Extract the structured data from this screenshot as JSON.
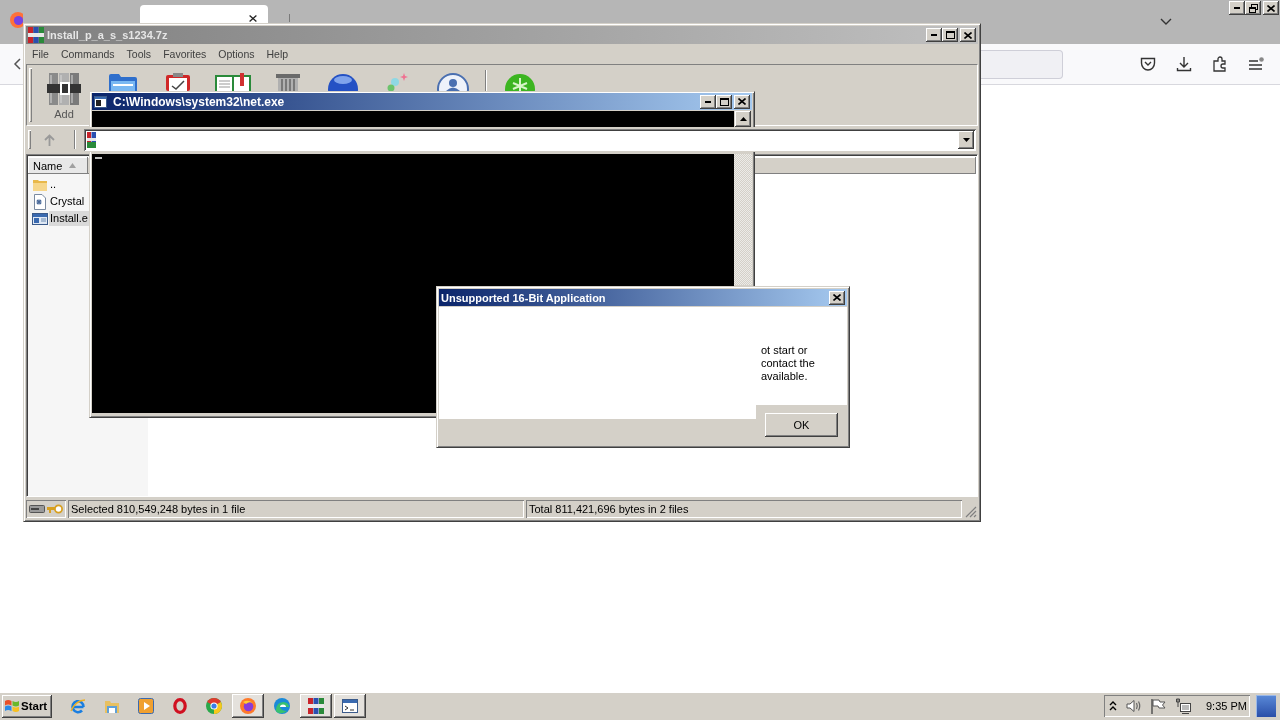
{
  "browser": {
    "tabs": [
      {
        "selected": true
      }
    ]
  },
  "archive_window": {
    "title": "Install_p_a_s_s1234.7z",
    "active": false,
    "menu": [
      "File",
      "Commands",
      "Tools",
      "Favorites",
      "Options",
      "Help"
    ],
    "toolbar": [
      {
        "kind": "add",
        "label": "Add"
      },
      {
        "kind": "folder"
      },
      {
        "kind": "clipboard"
      },
      {
        "kind": "book"
      },
      {
        "kind": "trash"
      },
      {
        "kind": "orb"
      },
      {
        "kind": "sparkle"
      },
      {
        "kind": "person"
      },
      {
        "kind": "separator"
      },
      {
        "kind": "disc"
      }
    ],
    "file_list": {
      "columns": [
        {
          "label": "Name",
          "sorted": true
        }
      ],
      "rows": [
        {
          "name": "..",
          "kind": "folder",
          "selected": false
        },
        {
          "name": "Crystal",
          "kind": "document",
          "selected": false
        },
        {
          "name": "Install.e",
          "kind": "program",
          "selected": true
        }
      ]
    },
    "status_bar": [
      "Selected 810,549,248 bytes in 1 file",
      "Total 811,421,696 bytes in 2 files"
    ]
  },
  "console_window": {
    "title": "C:\\Windows\\system32\\net.exe",
    "active": true
  },
  "dialog": {
    "title": "Unsupported 16-Bit Application",
    "active": true,
    "message_lines": [
      "ot start or",
      "contact the",
      "available."
    ],
    "buttons": [
      "OK"
    ]
  },
  "taskbar": {
    "start_label": "Start",
    "apps": [
      {
        "kind": "ie",
        "running": false
      },
      {
        "kind": "explorer",
        "running": false
      },
      {
        "kind": "media",
        "running": false
      },
      {
        "kind": "opera",
        "running": false
      },
      {
        "kind": "chrome",
        "running": false
      },
      {
        "kind": "firefox",
        "running": true
      },
      {
        "kind": "edge",
        "running": false
      },
      {
        "kind": "archiver",
        "running": true
      },
      {
        "kind": "console",
        "running": true
      }
    ],
    "clock": "9:35 PM"
  }
}
